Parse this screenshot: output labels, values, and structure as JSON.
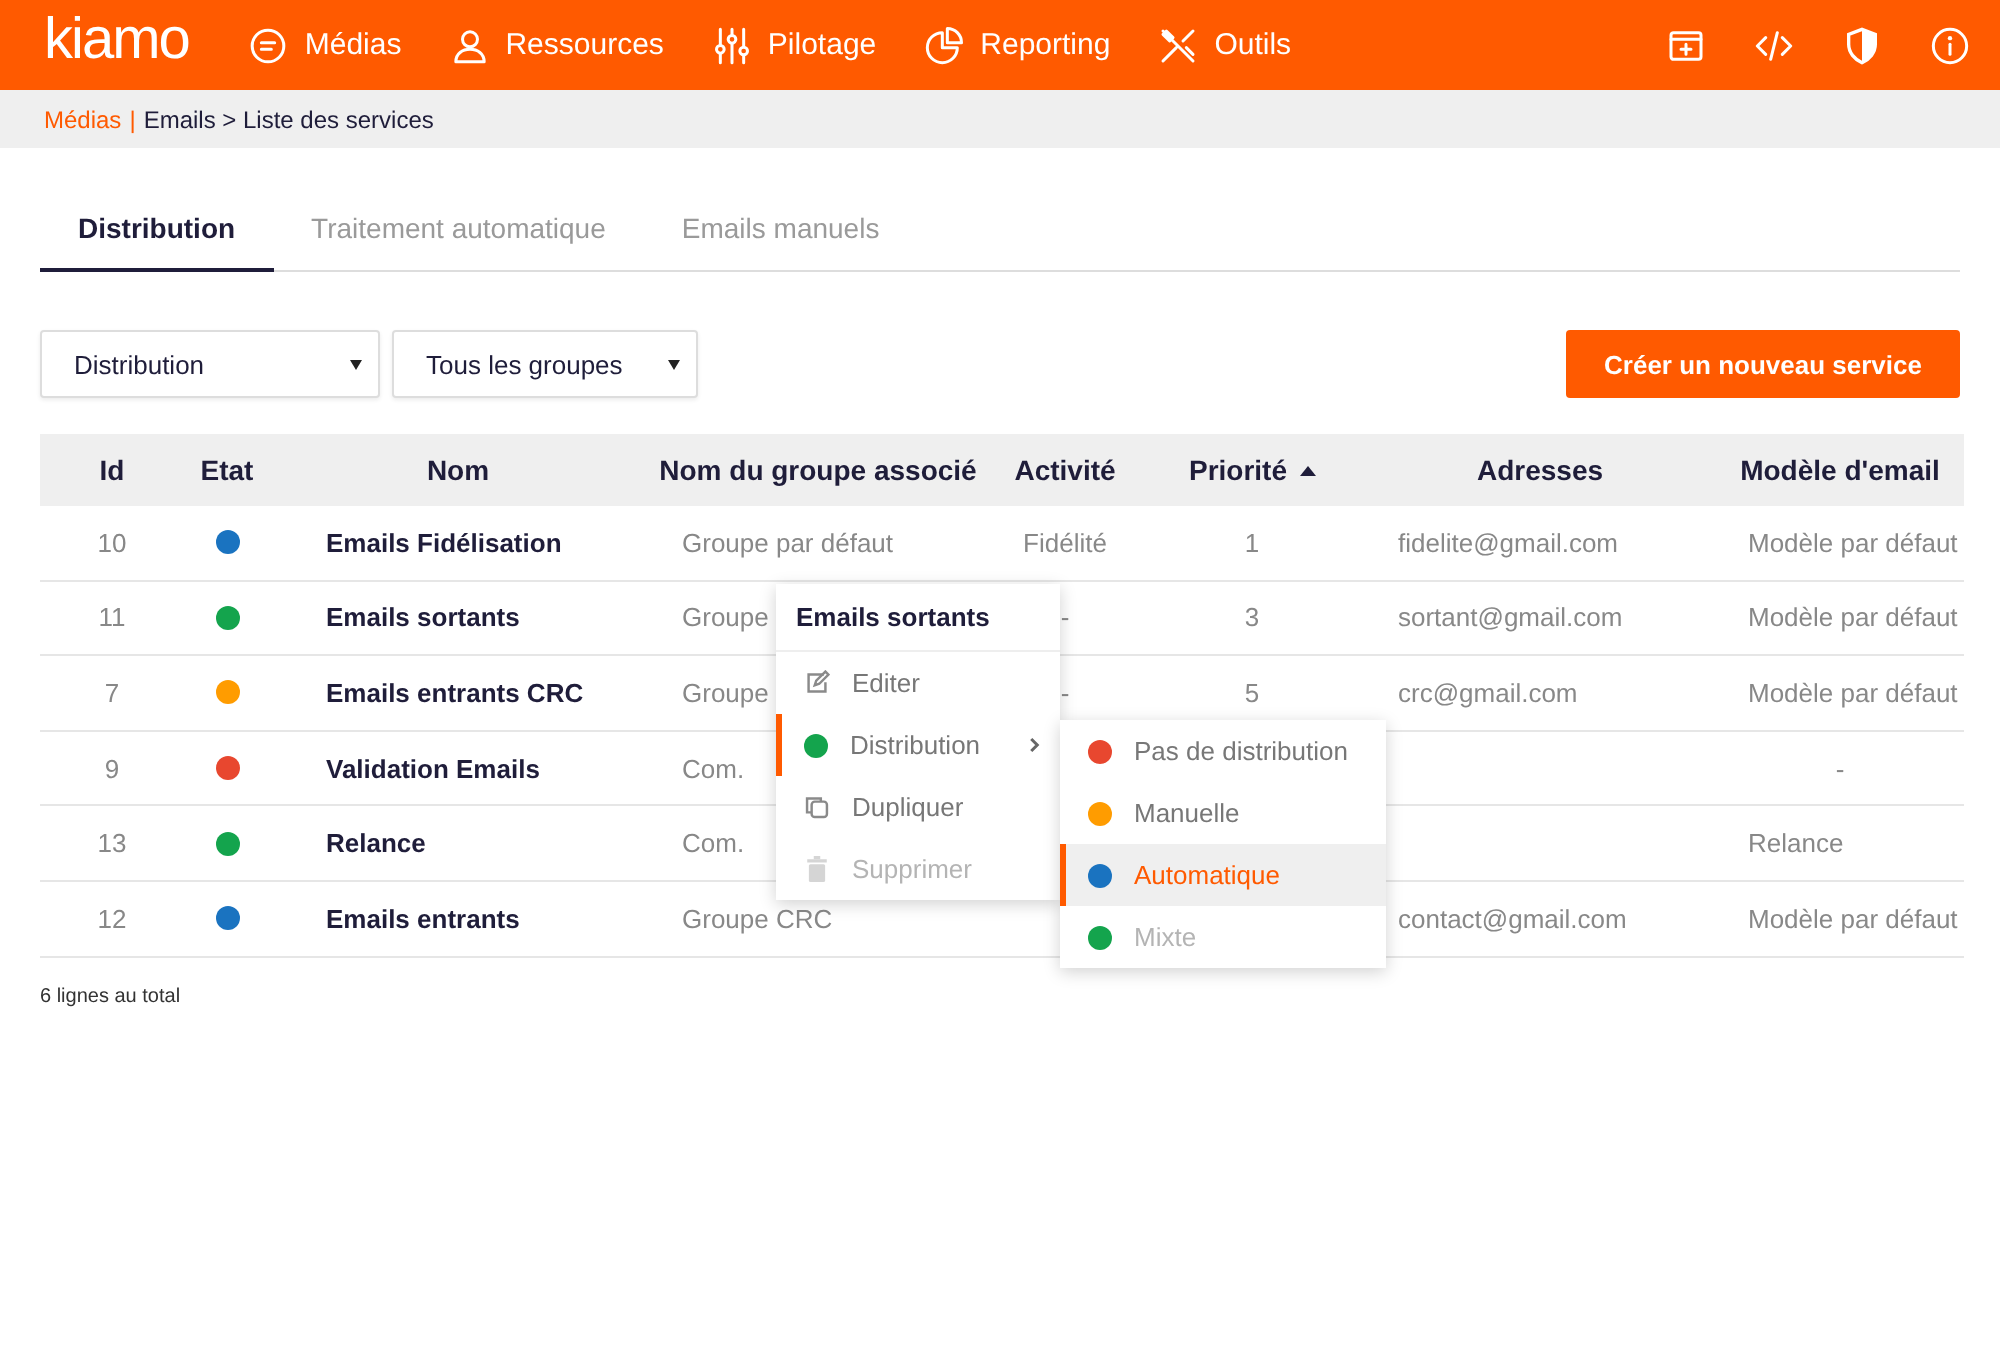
{
  "topbar": {
    "logo": "kiamo",
    "nav": [
      {
        "label": "Médias",
        "kind": "chat"
      },
      {
        "label": "Ressources",
        "kind": "user"
      },
      {
        "label": "Pilotage",
        "kind": "sliders"
      },
      {
        "label": "Reporting",
        "kind": "pie"
      },
      {
        "label": "Outils",
        "kind": "tools"
      }
    ],
    "actions": [
      {
        "kind": "window"
      },
      {
        "kind": "code"
      },
      {
        "kind": "shield"
      },
      {
        "kind": "info"
      }
    ]
  },
  "breadcrumb": [
    {
      "label": "Médias",
      "kind": "link"
    },
    {
      "label": "|",
      "kind": "separator"
    },
    {
      "label": "Emails > Liste des services",
      "kind": "current"
    }
  ],
  "tabs": [
    {
      "label": "Distribution",
      "selected": true
    },
    {
      "label": "Traitement automatique",
      "selected": false
    },
    {
      "label": "Emails manuels",
      "selected": false
    }
  ],
  "filters": [
    {
      "value": "Distribution"
    },
    {
      "value": "Tous les groupes"
    }
  ],
  "create_button": "Créer un nouveau service",
  "table": {
    "columns": [
      {
        "label": "Id",
        "sorted": false
      },
      {
        "label": "Etat",
        "sorted": false
      },
      {
        "label": "Nom",
        "sorted": false
      },
      {
        "label": "Nom du groupe associé",
        "sorted": false
      },
      {
        "label": "Activité",
        "sorted": false
      },
      {
        "label": "Priorité",
        "sorted": true
      },
      {
        "label": "Adresses",
        "sorted": false
      },
      {
        "label": "Modèle d'email",
        "sorted": false
      }
    ],
    "rows": [
      {
        "id": "10",
        "color": "#1a73c0",
        "name": "Emails Fidélisation",
        "group": "Groupe par défaut",
        "activity": "Fidélité",
        "priority": "1",
        "address": "fidelite@gmail.com",
        "template": "Modèle par défaut"
      },
      {
        "id": "11",
        "color": "#14a44d",
        "name": "Emails sortants",
        "group": "Groupe",
        "activity": "-",
        "priority": "3",
        "address": "sortant@gmail.com",
        "template": "Modèle par défaut"
      },
      {
        "id": "7",
        "color": "#ff9c00",
        "name": "Emails entrants CRC",
        "group": "Groupe",
        "activity": "-",
        "priority": "5",
        "address": "crc@gmail.com",
        "template": "Modèle par défaut"
      },
      {
        "id": "9",
        "color": "#e8472f",
        "name": "Validation Emails",
        "group": "Com.",
        "template": "-"
      },
      {
        "id": "13",
        "color": "#14a44d",
        "name": "Relance",
        "group": "Com.",
        "template": "Relance"
      },
      {
        "id": "12",
        "color": "#1a73c0",
        "name": "Emails entrants",
        "group": "Groupe CRC",
        "address": "contact@gmail.com",
        "template": "Modèle par défaut"
      }
    ]
  },
  "footer": "6 lignes au total",
  "context_menu": {
    "title": "Emails sortants",
    "items": [
      {
        "label": "Editer",
        "kind": "edit",
        "expanded": false,
        "disabled": false
      },
      {
        "label": "Distribution",
        "kind": "state",
        "color": "#14a44d",
        "expanded": true,
        "disabled": false
      },
      {
        "label": "Dupliquer",
        "kind": "copy",
        "expanded": false,
        "disabled": false
      },
      {
        "label": "Supprimer",
        "kind": "delete",
        "expanded": false,
        "disabled": true
      }
    ]
  },
  "submenu": [
    {
      "label": "Pas de distribution",
      "color": "#e8472f",
      "selected": false,
      "disabled": false
    },
    {
      "label": "Manuelle",
      "color": "#ff9c00",
      "selected": false,
      "disabled": false
    },
    {
      "label": "Automatique",
      "color": "#1a73c0",
      "selected": true,
      "disabled": false
    },
    {
      "label": "Mixte",
      "color": "#14a44d",
      "selected": false,
      "disabled": true
    }
  ]
}
